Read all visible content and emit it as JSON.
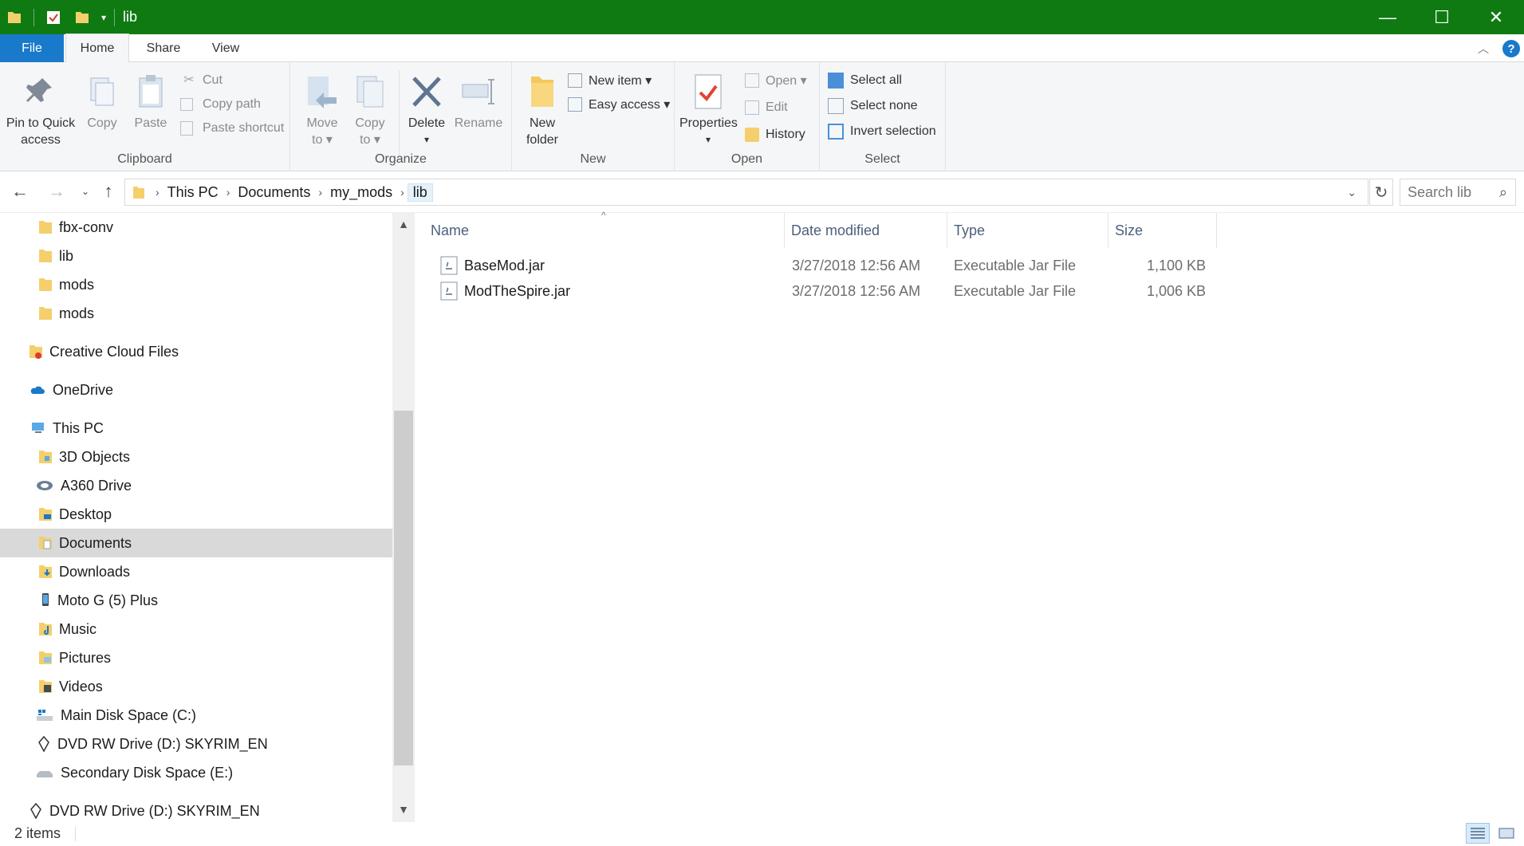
{
  "window": {
    "title": "lib",
    "minimize": "—",
    "maximize": "☐",
    "close": "✕"
  },
  "tabs": {
    "file": "File",
    "home": "Home",
    "share": "Share",
    "view": "View"
  },
  "ribbon": {
    "clipboard": {
      "label": "Clipboard",
      "pin_line1": "Pin to Quick",
      "pin_line2": "access",
      "copy": "Copy",
      "paste": "Paste",
      "cut": "Cut",
      "copy_path": "Copy path",
      "paste_shortcut": "Paste shortcut"
    },
    "organize": {
      "label": "Organize",
      "move_line1": "Move",
      "move_line2": "to ▾",
      "copy_line1": "Copy",
      "copy_line2": "to ▾",
      "delete": "Delete",
      "delete_arrow": "▾",
      "rename": "Rename"
    },
    "new": {
      "label": "New",
      "folder_line1": "New",
      "folder_line2": "folder",
      "new_item": "New item ▾",
      "easy_access": "Easy access ▾"
    },
    "open": {
      "label": "Open",
      "properties": "Properties",
      "properties_arrow": "▾",
      "open": "Open ▾",
      "edit": "Edit",
      "history": "History"
    },
    "select": {
      "label": "Select",
      "select_all": "Select all",
      "select_none": "Select none",
      "invert": "Invert selection"
    }
  },
  "address": {
    "crumbs": [
      "This PC",
      "Documents",
      "my_mods",
      "lib"
    ],
    "search_placeholder": "Search lib"
  },
  "nav": {
    "items": [
      "fbx-conv",
      "lib",
      "mods",
      "mods",
      "Creative Cloud Files",
      "OneDrive",
      "This PC",
      "3D Objects",
      "A360 Drive",
      "Desktop",
      "Documents",
      "Downloads",
      "Moto G (5) Plus",
      "Music",
      "Pictures",
      "Videos",
      "Main Disk Space (C:)",
      "DVD RW Drive (D:) SKYRIM_EN",
      "Secondary Disk Space (E:)",
      "DVD RW Drive (D:) SKYRIM_EN"
    ],
    "selected": "Documents"
  },
  "columns": {
    "name": "Name",
    "date": "Date modified",
    "type": "Type",
    "size": "Size"
  },
  "files": [
    {
      "name": "BaseMod.jar",
      "date": "3/27/2018 12:56 AM",
      "type": "Executable Jar File",
      "size": "1,100 KB"
    },
    {
      "name": "ModTheSpire.jar",
      "date": "3/27/2018 12:56 AM",
      "type": "Executable Jar File",
      "size": "1,006 KB"
    }
  ],
  "status": {
    "count": "2 items"
  },
  "colors": {
    "titlebar": "#0f7a12",
    "file_tab": "#1979ca",
    "folder": "#e8b84a"
  }
}
